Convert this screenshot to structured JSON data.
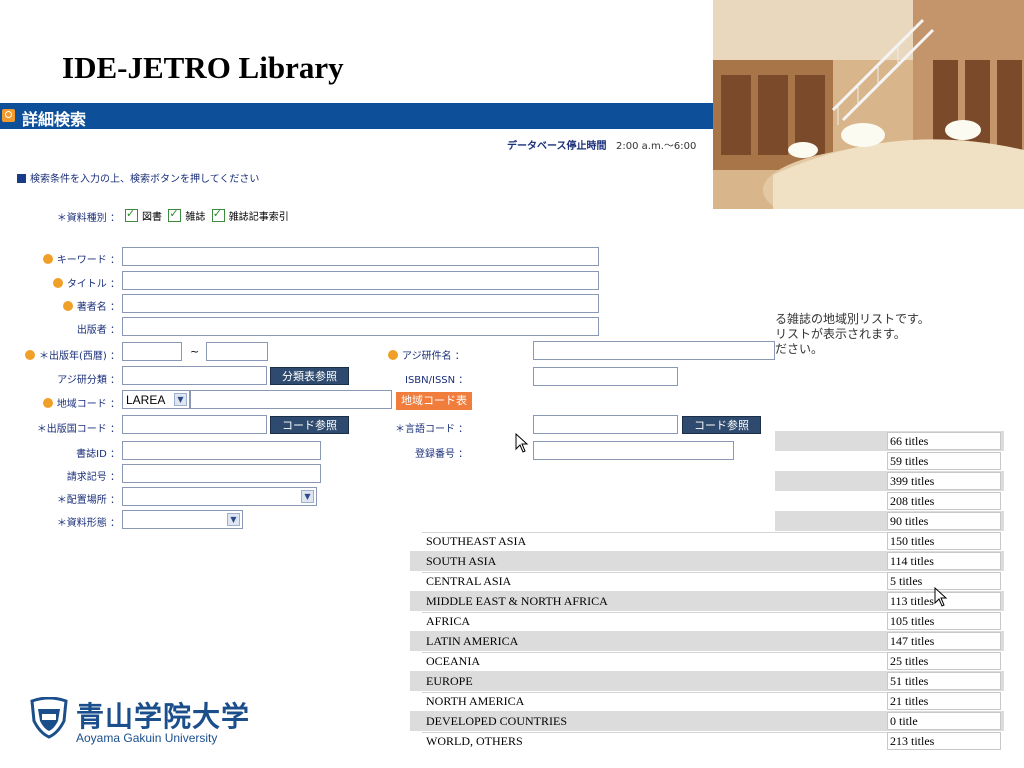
{
  "slide": {
    "title": "IDE-JETRO Library"
  },
  "header": {
    "title": "詳細検索"
  },
  "db_notice": {
    "label": "データベース停止時間",
    "time": "2:00 a.m.～6:00"
  },
  "instruction": "検索条件を入力の上、検索ボタンを押してください",
  "material_type": {
    "label": "＊資料種別 ：",
    "options": [
      "図書",
      "雑誌",
      "雑誌記事索引"
    ]
  },
  "form": {
    "keyword": "キーワード ：",
    "title": "タイトル ：",
    "author": "著者名 ：",
    "publisher": "出版者 ：",
    "pub_year": "＊出版年(西暦) ：",
    "tilde": "~",
    "ajiken_subject": "アジ研件名 ：",
    "ajiken_class": "アジ研分類 ：",
    "class_button": "分類表参照",
    "isbn": "ISBN/ISSN ：",
    "region_code": "地域コード ：",
    "region_value": "LAREA",
    "region_button": "地域コード表",
    "country_code": "＊出版国コード ：",
    "code_button": "コード参照",
    "language_code": "＊言語コード ：",
    "code_button2": "コード参照",
    "book_id": "書誌ID ：",
    "reg_no": "登録番号 ：",
    "call_no": "請求記号 ：",
    "location": "＊配置場所 ：",
    "form_type": "＊資料形態 ："
  },
  "overlay_text": [
    "る雑誌の地域別リストです。",
    "リストが表示されます。",
    "ださい。"
  ],
  "region_list": [
    {
      "name": "",
      "count": "66 titles"
    },
    {
      "name": "",
      "count": "59 titles"
    },
    {
      "name": "",
      "count": "399 titles"
    },
    {
      "name": "",
      "count": "208 titles"
    },
    {
      "name": "",
      "count": "90 titles"
    },
    {
      "name": "SOUTHEAST ASIA",
      "count": "150 titles"
    },
    {
      "name": "SOUTH ASIA",
      "count": "114 titles"
    },
    {
      "name": "CENTRAL ASIA",
      "count": "5 titles"
    },
    {
      "name": "MIDDLE EAST & NORTH AFRICA",
      "count": "113 titles"
    },
    {
      "name": "AFRICA",
      "count": "105 titles"
    },
    {
      "name": "LATIN AMERICA",
      "count": "147 titles"
    },
    {
      "name": "OCEANIA",
      "count": "25 titles"
    },
    {
      "name": "EUROPE",
      "count": "51 titles"
    },
    {
      "name": "NORTH AMERICA",
      "count": "21 titles"
    },
    {
      "name": "DEVELOPED COUNTRIES",
      "count": "0 title"
    },
    {
      "name": "WORLD,  OTHERS",
      "count": "213 titles"
    }
  ],
  "logo": {
    "jp": "青山学院大学",
    "en": "Aoyama Gakuin University"
  }
}
